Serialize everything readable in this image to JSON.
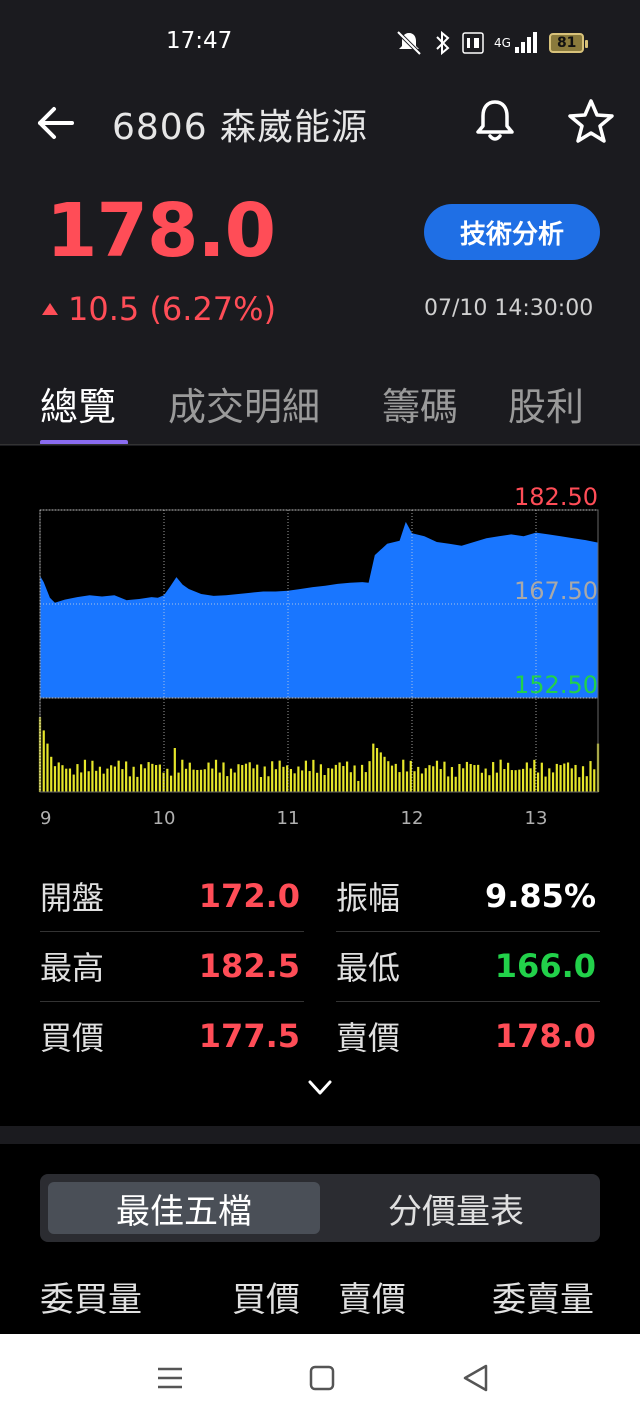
{
  "status_bar": {
    "time": "17:47",
    "network": "4G",
    "battery": "81"
  },
  "header": {
    "title": "6806 森崴能源",
    "price": "178.0",
    "change": "10.5 (6.27%)",
    "technical_button": "技術分析",
    "timestamp": "07/10 14:30:00"
  },
  "tabs": [
    "總覽",
    "成交明細",
    "籌碼",
    "股利"
  ],
  "active_tab": 0,
  "chart_data": {
    "type": "area",
    "y_ticks": [
      {
        "label": "182.50",
        "value": 182.5,
        "color": "#ff4d57"
      },
      {
        "label": "167.50",
        "value": 167.5,
        "color": "#a9a9a9"
      },
      {
        "label": "152.50",
        "value": 152.5,
        "color": "#22d14a"
      }
    ],
    "x_ticks": [
      {
        "label": "9",
        "hour": 9
      },
      {
        "label": "10",
        "hour": 10
      },
      {
        "label": "11",
        "hour": 11
      },
      {
        "label": "12",
        "hour": 12
      },
      {
        "label": "13",
        "hour": 13
      }
    ],
    "ylim": [
      152.5,
      182.5
    ],
    "xlim": [
      9,
      13.5
    ],
    "price_series": [
      [
        9.0,
        172.0
      ],
      [
        9.03,
        171.0
      ],
      [
        9.08,
        168.5
      ],
      [
        9.12,
        167.7
      ],
      [
        9.2,
        168.2
      ],
      [
        9.3,
        168.6
      ],
      [
        9.4,
        168.9
      ],
      [
        9.5,
        168.7
      ],
      [
        9.6,
        168.9
      ],
      [
        9.7,
        168.1
      ],
      [
        9.8,
        168.3
      ],
      [
        9.9,
        168.6
      ],
      [
        9.95,
        168.5
      ],
      [
        10.0,
        168.9
      ],
      [
        10.05,
        170.3
      ],
      [
        10.1,
        171.8
      ],
      [
        10.15,
        170.6
      ],
      [
        10.2,
        169.9
      ],
      [
        10.3,
        169.1
      ],
      [
        10.4,
        168.8
      ],
      [
        10.5,
        168.9
      ],
      [
        10.6,
        169.1
      ],
      [
        10.7,
        169.3
      ],
      [
        10.8,
        169.5
      ],
      [
        10.9,
        169.5
      ],
      [
        11.0,
        169.6
      ],
      [
        11.1,
        169.9
      ],
      [
        11.2,
        170.2
      ],
      [
        11.3,
        170.4
      ],
      [
        11.4,
        170.7
      ],
      [
        11.5,
        170.9
      ],
      [
        11.6,
        171.0
      ],
      [
        11.65,
        170.9
      ],
      [
        11.7,
        175.3
      ],
      [
        11.8,
        177.1
      ],
      [
        11.9,
        177.6
      ],
      [
        11.95,
        180.6
      ],
      [
        12.0,
        178.8
      ],
      [
        12.1,
        178.3
      ],
      [
        12.2,
        177.4
      ],
      [
        12.3,
        177.1
      ],
      [
        12.4,
        176.8
      ],
      [
        12.5,
        177.4
      ],
      [
        12.6,
        178.0
      ],
      [
        12.7,
        178.3
      ],
      [
        12.8,
        178.6
      ],
      [
        12.9,
        178.3
      ],
      [
        13.0,
        178.9
      ],
      [
        13.1,
        178.6
      ],
      [
        13.2,
        178.3
      ],
      [
        13.3,
        178.0
      ],
      [
        13.4,
        177.7
      ],
      [
        13.5,
        177.3
      ]
    ],
    "price_color": "#1976ff",
    "volume_color": "#e6e62a"
  },
  "stats": [
    {
      "left_label": "開盤",
      "left_value": "172.0",
      "left_color": "#ff4d57",
      "right_label": "振幅",
      "right_value": "9.85%",
      "right_color": "#ffffff"
    },
    {
      "left_label": "最高",
      "left_value": "182.5",
      "left_color": "#ff4d57",
      "right_label": "最低",
      "right_value": "166.0",
      "right_color": "#22d14a"
    },
    {
      "left_label": "買價",
      "left_value": "177.5",
      "left_color": "#ff4d57",
      "right_label": "賣價",
      "right_value": "178.0",
      "right_color": "#ff4d57"
    }
  ],
  "segment": {
    "best5": "最佳五檔",
    "price_volume": "分價量表"
  },
  "orderbook_header": {
    "bid_qty": "委買量",
    "bid_price": "買價",
    "ask_price": "賣價",
    "ask_qty": "委賣量"
  },
  "colors": {
    "up": "#ff4d57",
    "down": "#22d14a",
    "accent": "#1f6fe5",
    "tab_indicator": "#8a6cf0"
  }
}
